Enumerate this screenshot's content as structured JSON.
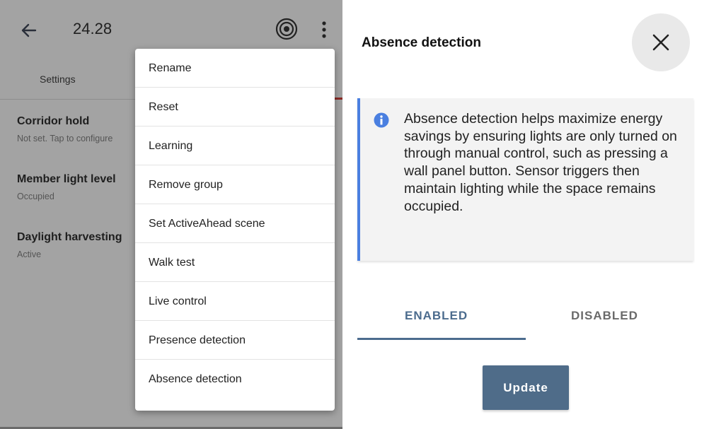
{
  "left": {
    "title": "24.28",
    "tabs": [
      {
        "label": "Settings"
      }
    ],
    "settings": [
      {
        "title": "Corridor hold",
        "subtitle": "Not set. Tap to configure"
      },
      {
        "title": "Member light level",
        "subtitle": "Occupied"
      },
      {
        "title": "Daylight harvesting",
        "subtitle": "Active"
      }
    ],
    "icons": {
      "back": "arrow-left-icon",
      "radar": "radar-icon",
      "more": "kebab-icon"
    }
  },
  "menu": {
    "items": [
      {
        "label": "Rename"
      },
      {
        "label": "Reset"
      },
      {
        "label": "Learning"
      },
      {
        "label": "Remove group"
      },
      {
        "label": "Set ActiveAhead scene"
      },
      {
        "label": "Walk test"
      },
      {
        "label": "Live control"
      },
      {
        "label": "Presence detection"
      },
      {
        "label": "Absence detection"
      }
    ]
  },
  "dialog": {
    "title": "Absence detection",
    "info": "Absence detection helps maximize energy savings by ensuring lights are only turned on through manual control, such as pressing a wall panel button. Sensor triggers then maintain lighting while the space remains occupied.",
    "options": [
      {
        "label": "ENABLED",
        "selected": true
      },
      {
        "label": "DISABLED",
        "selected": false
      }
    ],
    "update_label": "Update"
  },
  "colors": {
    "accent": "#4f6c89",
    "info_border": "#4a7fe0",
    "tab_indicator": "#8a2a25",
    "scrim": "#a3a3a3"
  }
}
